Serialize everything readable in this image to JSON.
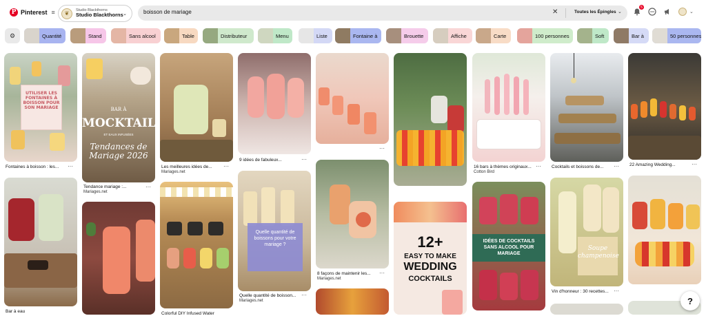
{
  "header": {
    "logo_text": "Pinterest",
    "account_small": "Studio Blackthorns",
    "account_name": "Studio Blackthorns",
    "search_value": "boisson de mariage",
    "search_scope": "Toutes les Épingles",
    "notification_count": "5"
  },
  "filters": [
    {
      "label": "Quantité",
      "color": "#a8b4f0"
    },
    {
      "label": "Stand",
      "color": "#f6c6e8"
    },
    {
      "label": "Sans alcool",
      "color": "#f8d0d2"
    },
    {
      "label": "Table",
      "color": "#f7d9c1"
    },
    {
      "label": "Distributeur",
      "color": "#cfe9cc"
    },
    {
      "label": "Menu",
      "color": "#bfe8c8"
    },
    {
      "label": "Liste",
      "color": "#d3d8f5"
    },
    {
      "label": "Fontaine à",
      "color": "#aab7f0"
    },
    {
      "label": "Brouette",
      "color": "#f5ccea"
    },
    {
      "label": "Affiche",
      "color": "#f9d6d6"
    },
    {
      "label": "Carte",
      "color": "#f8dcc6"
    },
    {
      "label": "100 personnes",
      "color": "#cfeccb"
    },
    {
      "label": "Soft",
      "color": "#bfe8c8"
    },
    {
      "label": "Bar à",
      "color": "#d5daf6"
    },
    {
      "label": "50 personnes",
      "color": "#aab7f0"
    }
  ],
  "pins": {
    "p1": {
      "title": "Fontaines à boisson : les...",
      "overlay": "UTILISER LES FONTAINES À BOISSON POUR SON MARIAGE"
    },
    "p2": {
      "title": "Bar à eau"
    },
    "p3": {
      "title": "Tendance mariage :...",
      "source": "Mariages.net",
      "overlay_top": "BAR À",
      "overlay_main": "MOCKTAIL",
      "overlay_sub": "ET EAUX INFUSÉES",
      "overlay_script": "Tendances de Mariage 2026"
    },
    "p5": {
      "title": "Les meilleures idées de...",
      "source": "Mariages.net"
    },
    "p6": {
      "title": "Colorful DIY Infused Water"
    },
    "p7": {
      "title": "9 idées de fabuleux..."
    },
    "p8": {
      "title": "Quelle quantité de boisson...",
      "source": "Mariages.net",
      "overlay": "Quelle quantité de boissons pour votre mariage ?"
    },
    "p9": {
      "title": "8 façons de maintenir les...",
      "source": "Mariages.net"
    },
    "p12": {
      "overlay_main": "12+",
      "overlay_line1": "EASY TO MAKE",
      "overlay_line2": "WEDDING",
      "overlay_line3": "COCKTAILS"
    },
    "p13": {
      "title": "16 bars à thèmes originaux...",
      "source": "Cotton Bird"
    },
    "p14": {
      "overlay": "IDÉES DE COCKTAILS SANS ALCOOL POUR MARIAGE"
    },
    "p15": {
      "title": "Cocktails et boissons de..."
    },
    "p16": {
      "title": "Vin d'honneur : 30 recettes...",
      "overlay": "Soupe champenoise"
    },
    "p18": {
      "title": "22 Amazing Wedding..."
    }
  }
}
